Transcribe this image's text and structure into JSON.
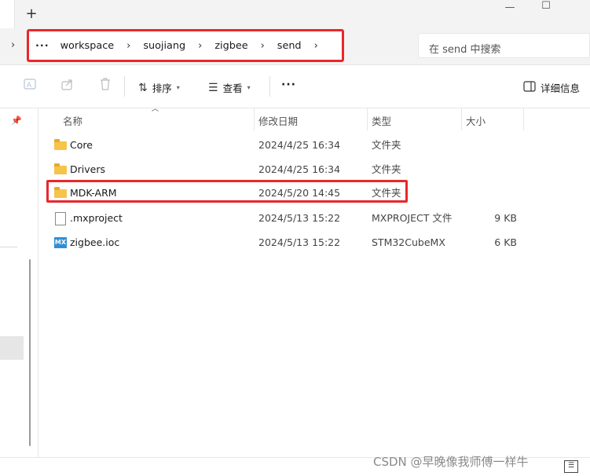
{
  "window": {
    "new_tab_symbol": "+",
    "minimize_symbol": "—",
    "maximize_symbol": "☐"
  },
  "breadcrumb": {
    "overflow": "···",
    "items": [
      "workspace",
      "suojiang",
      "zigbee",
      "send"
    ],
    "separator": "›"
  },
  "search": {
    "placeholder": "在 send 中搜索"
  },
  "toolbar": {
    "sort_label": "排序",
    "view_label": "查看",
    "more_label": "···",
    "details_label": "详细信息"
  },
  "columns": {
    "name": "名称",
    "date_modified": "修改日期",
    "type": "类型",
    "size": "大小"
  },
  "files": [
    {
      "name": "Core",
      "date": "2024/4/25 16:34",
      "type": "文件夹",
      "size": "",
      "icon": "folder-icon"
    },
    {
      "name": "Drivers",
      "date": "2024/4/25 16:34",
      "type": "文件夹",
      "size": "",
      "icon": "folder-icon"
    },
    {
      "name": "MDK-ARM",
      "date": "2024/5/20 14:45",
      "type": "文件夹",
      "size": "",
      "icon": "folder-icon"
    },
    {
      "name": ".mxproject",
      "date": "2024/5/13 15:22",
      "type": "MXPROJECT 文件",
      "size": "9 KB",
      "icon": "file-icon"
    },
    {
      "name": "zigbee.ioc",
      "date": "2024/5/13 15:22",
      "type": "STM32CubeMX",
      "size": "6 KB",
      "icon": "stm32cubemx-icon"
    }
  ],
  "mx_icon_text": "MX",
  "watermark": "CSDN @早晚像我师傅一样牛",
  "colors": {
    "highlight_red": "#e8282a",
    "folder_yellow": "#f5c449"
  }
}
